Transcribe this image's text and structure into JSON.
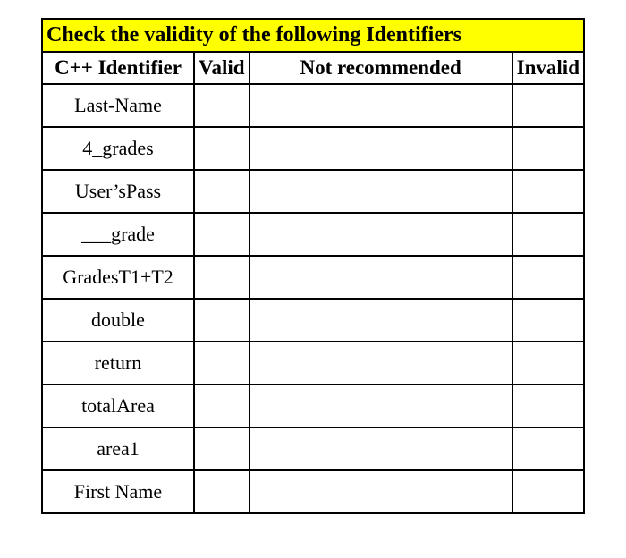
{
  "table": {
    "title": "Check the validity of the following Identifiers",
    "columns": [
      "C++ Identifier",
      "Valid",
      "Not recommended",
      "Invalid"
    ],
    "rows": [
      {
        "identifier": "Last-Name",
        "valid": "",
        "not_recommended": "",
        "invalid": ""
      },
      {
        "identifier": "4_grades",
        "valid": "",
        "not_recommended": "",
        "invalid": ""
      },
      {
        "identifier": "User’sPass",
        "valid": "",
        "not_recommended": "",
        "invalid": ""
      },
      {
        "identifier": "___grade",
        "valid": "",
        "not_recommended": "",
        "invalid": ""
      },
      {
        "identifier": "GradesT1+T2",
        "valid": "",
        "not_recommended": "",
        "invalid": ""
      },
      {
        "identifier": "double",
        "valid": "",
        "not_recommended": "",
        "invalid": ""
      },
      {
        "identifier": "return",
        "valid": "",
        "not_recommended": "",
        "invalid": ""
      },
      {
        "identifier": "totalArea",
        "valid": "",
        "not_recommended": "",
        "invalid": ""
      },
      {
        "identifier": "area1",
        "valid": "",
        "not_recommended": "",
        "invalid": ""
      },
      {
        "identifier": "First Name",
        "valid": "",
        "not_recommended": "",
        "invalid": ""
      }
    ]
  }
}
